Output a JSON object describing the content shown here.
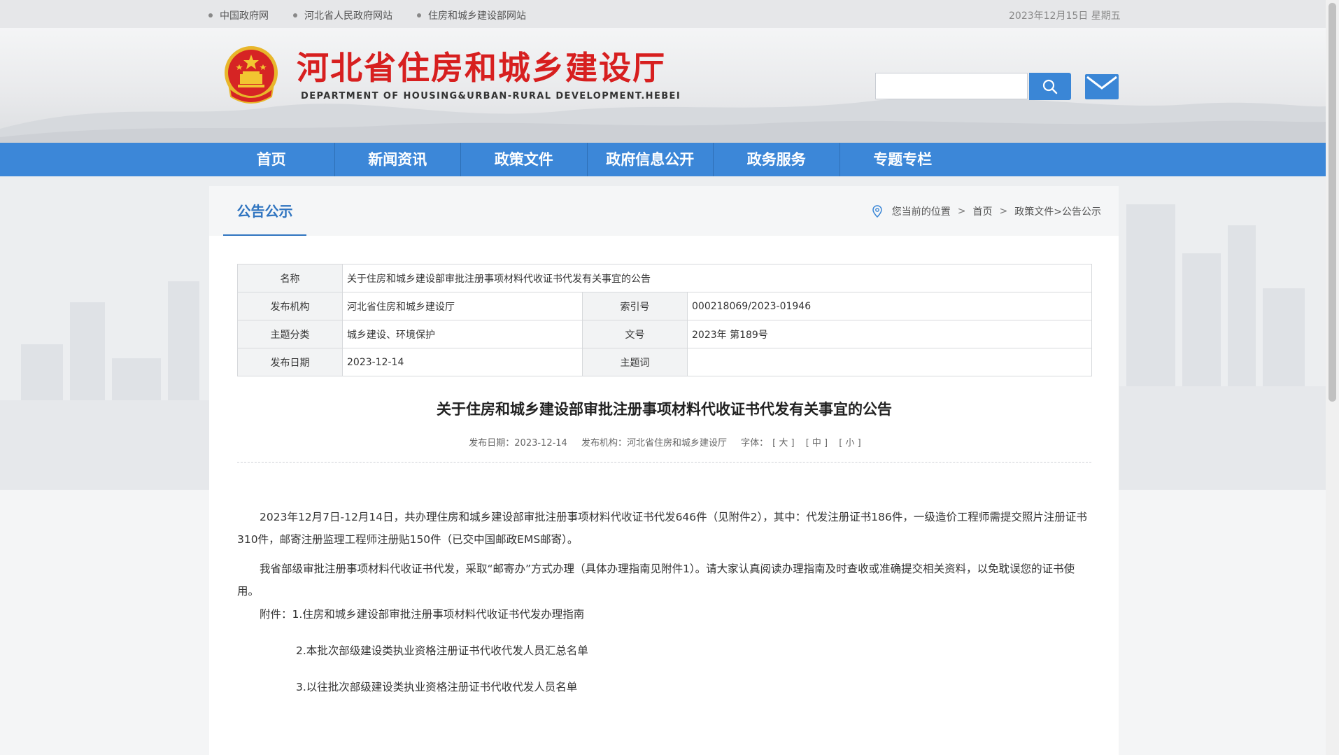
{
  "topbar": {
    "links": [
      "中国政府网",
      "河北省人民政府网站",
      "住房和城乡建设部网站"
    ],
    "date": "2023年12月15日 星期五"
  },
  "header": {
    "title": "河北省住房和城乡建设厅",
    "subtitle": "DEPARTMENT OF HOUSING&URBAN-RURAL DEVELOPMENT.HEBEI",
    "search_placeholder": ""
  },
  "nav": [
    "首页",
    "新闻资讯",
    "政策文件",
    "政府信息公开",
    "政务服务",
    "专题专栏"
  ],
  "panel": {
    "tab": "公告公示",
    "breadcrumb": {
      "prefix": "您当前的位置",
      "home": "首页",
      "path": "政策文件>公告公示"
    }
  },
  "info": {
    "name_label": "名称",
    "name": "关于住房和城乡建设部审批注册事项材料代收证书代发有关事宜的公告",
    "publisher_label": "发布机构",
    "publisher": "河北省住房和城乡建设厅",
    "index_label": "索引号",
    "index": "000218069/2023-01946",
    "topic_label": "主题分类",
    "topic": "城乡建设、环境保护",
    "docno_label": "文号",
    "docno": "2023年 第189号",
    "date_label": "发布日期",
    "date": "2023-12-14",
    "keywords_label": "主题词",
    "keywords": ""
  },
  "article": {
    "title": "关于住房和城乡建设部审批注册事项材料代收证书代发有关事宜的公告",
    "meta_date": "发布日期：2023-12-14",
    "meta_org": "发布机构：河北省住房和城乡建设厅",
    "meta_font_label": "字体：",
    "font_large": "[ 大 ]",
    "font_medium": "[ 中 ]",
    "font_small": "[ 小 ]",
    "para1": "2023年12月7日-12月14日，共办理住房和城乡建设部审批注册事项材料代收证书代发646件（见附件2），其中：代发注册证书186件，一级造价工程师需提交照片注册证书310件，邮寄注册监理工程师注册贴150件（已交中国邮政EMS邮寄）。",
    "para2": "我省部级审批注册事项材料代收证书代发，采取“邮寄办”方式办理（具体办理指南见附件1）。请大家认真阅读办理指南及时查收或准确提交相关资料，以免耽误您的证书使用。",
    "attach1": "附件：1.住房和城乡建设部审批注册事项材料代收证书代发办理指南",
    "attach2": "2.本批次部级建设类执业资格注册证书代收代发人员汇总名单",
    "attach3": "3.以往批次部级建设类执业资格注册证书代收代发人员名单"
  },
  "colors": {
    "brand_red": "#d71f1f",
    "nav_blue": "#3c87d8",
    "accent_blue": "#2f74c0"
  },
  "icons": [
    "national-emblem-icon",
    "search-icon",
    "mail-icon",
    "location-pin-icon"
  ]
}
